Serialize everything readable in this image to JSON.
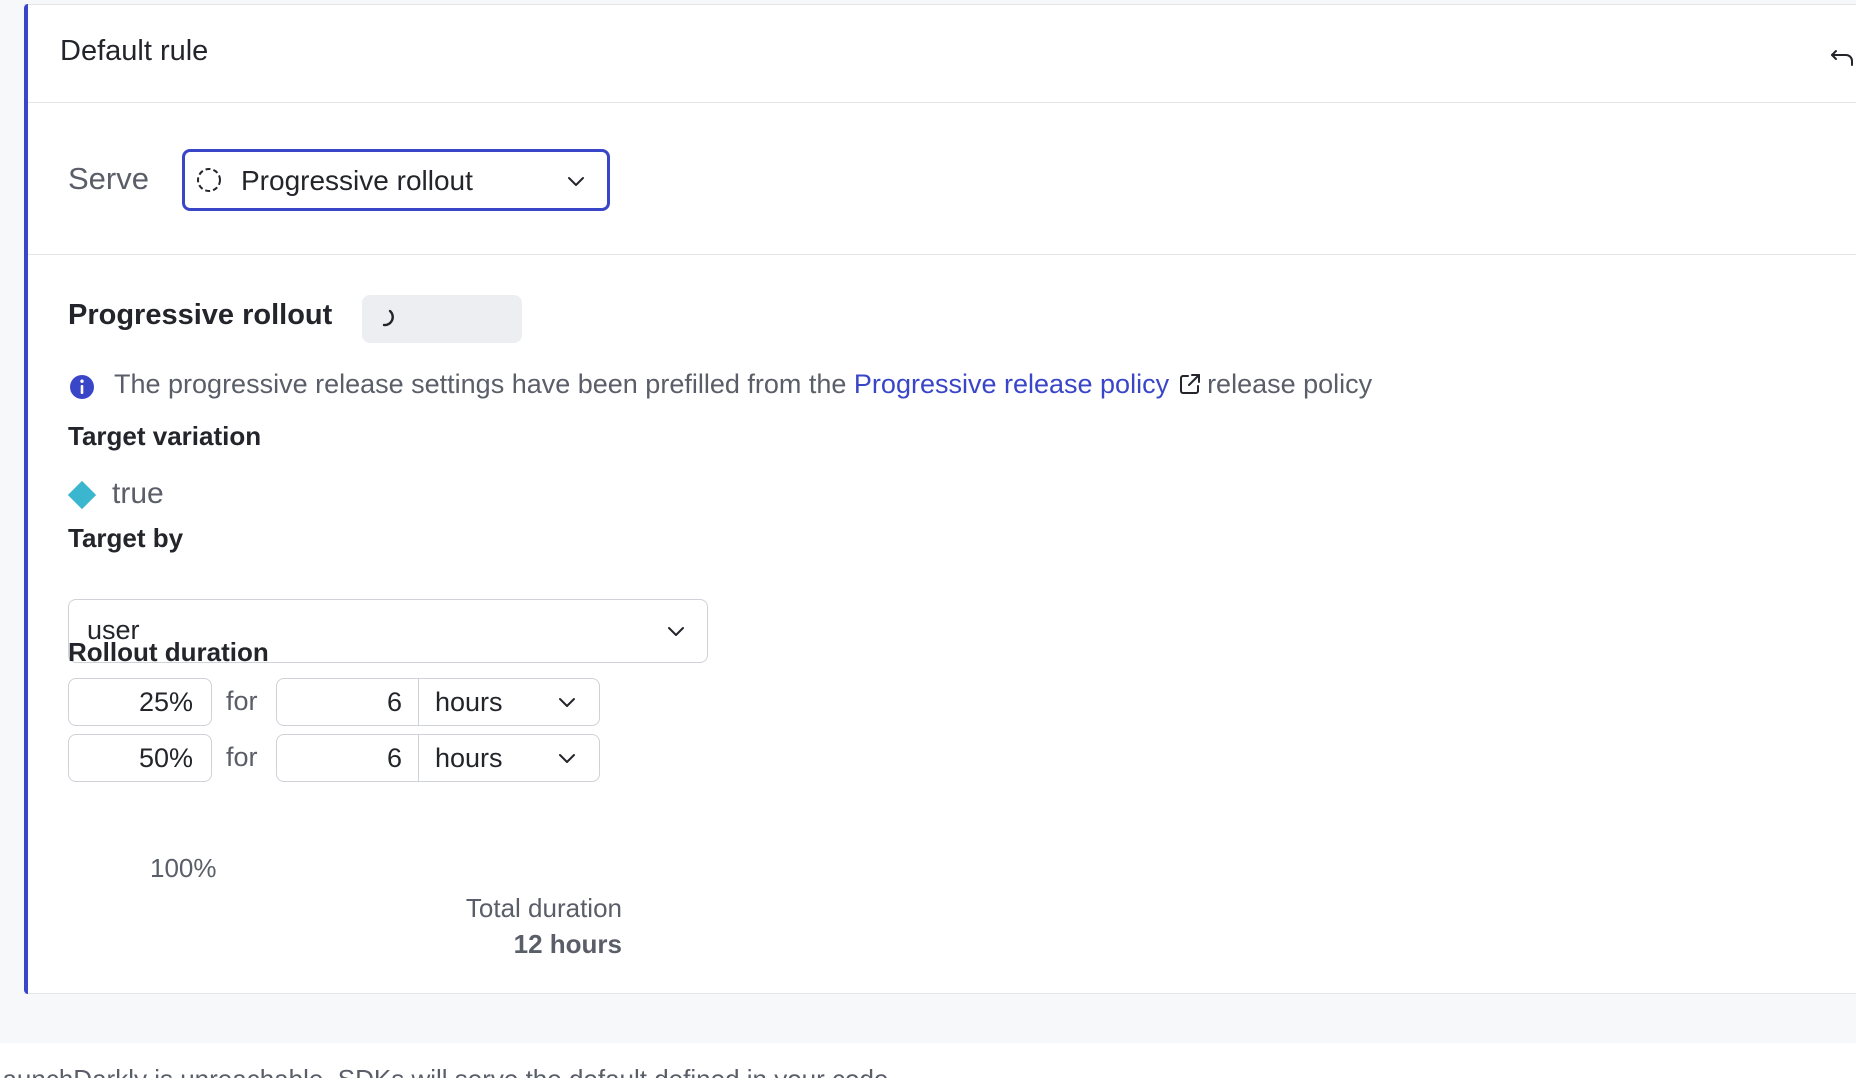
{
  "card": {
    "title": "Default rule",
    "undo_icon": "undo-icon"
  },
  "serve": {
    "label": "Serve",
    "selected": "Progressive rollout",
    "icon": "dashed-circle-icon"
  },
  "rollout": {
    "title": "Progressive rollout",
    "info": {
      "prefix": "The progressive release settings have been prefilled from the",
      "link_text": "Progressive release policy",
      "suffix": "release policy"
    },
    "target_variation": {
      "label": "Target variation",
      "value": "true",
      "color": "#3ab6cf"
    },
    "target_by": {
      "label": "Target by",
      "value": "user"
    },
    "rollout_duration": {
      "label": "Rollout duration",
      "steps": [
        {
          "percent": "25%",
          "for": "for",
          "duration": "6",
          "unit": "hours"
        },
        {
          "percent": "50%",
          "for": "for",
          "duration": "6",
          "unit": "hours"
        }
      ],
      "final_percent": "100%",
      "total_label": "Total duration",
      "total_value": "12 hours"
    }
  },
  "footer": {
    "text": "LaunchDarkly is unreachable, SDKs will serve the default defined in your code"
  },
  "colors": {
    "accent": "#3a46c8",
    "variation": "#3ab6cf"
  }
}
